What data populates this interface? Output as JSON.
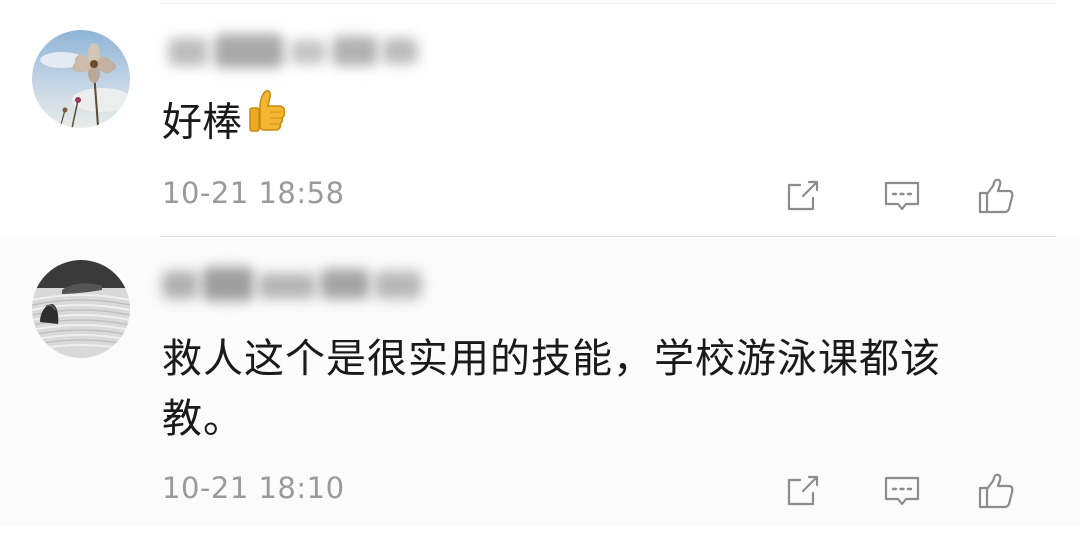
{
  "comments": [
    {
      "text": "好棒",
      "emoji": "thumbs-up-emoji",
      "timestamp": "10-21 18:58",
      "avatar": "cosmos-flower-photo"
    },
    {
      "text": "救人这个是很实用的技能，学校游泳课都该教。",
      "timestamp": "10-21 18:10",
      "avatar": "zen-garden-rock-photo"
    }
  ],
  "icons": {
    "share": "share-icon",
    "reply": "reply-comment-icon",
    "like": "like-thumb-icon"
  },
  "colors": {
    "text": "#1a1a1a",
    "meta": "#9a9a9a",
    "icon": "#8c8c8c",
    "emoji": "#f5b731"
  }
}
